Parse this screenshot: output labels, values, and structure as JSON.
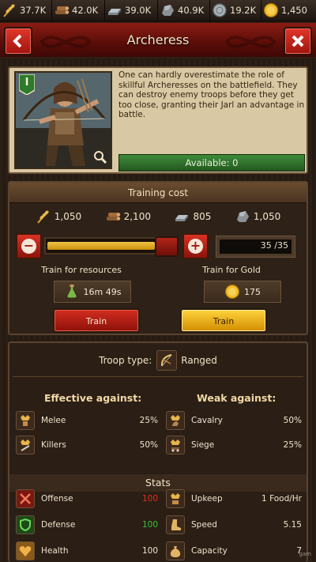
{
  "resources": [
    {
      "name": "food",
      "icon": "wheat-icon",
      "value": "37.7K"
    },
    {
      "name": "wood",
      "icon": "logs-icon",
      "value": "42.0K"
    },
    {
      "name": "iron",
      "icon": "iron-bars-icon",
      "value": "39.0K"
    },
    {
      "name": "stone",
      "icon": "stone-icon",
      "value": "40.9K"
    },
    {
      "name": "silver",
      "icon": "silver-icon",
      "value": "19.2K"
    },
    {
      "name": "gold",
      "icon": "gold-coin-icon",
      "value": "1,450"
    }
  ],
  "header": {
    "title": "Archeress",
    "back_icon": "back-arrow-icon",
    "close_icon": "close-x-icon"
  },
  "unit": {
    "rank": "I",
    "description": "One can hardly overestimate the role of skillful Archeresses on the battlefield. They can destroy enemy troops before they get too close, granting their Jarl an advantage in battle.",
    "available": "Available: 0"
  },
  "training": {
    "title": "Training cost",
    "costs": [
      {
        "icon": "wheat-icon",
        "value": "1,050"
      },
      {
        "icon": "logs-icon",
        "value": "2,100"
      },
      {
        "icon": "iron-bars-icon",
        "value": "805"
      },
      {
        "icon": "stone-icon",
        "value": "1,050"
      }
    ],
    "quantity": "35 /35",
    "slider_fraction": 1.0,
    "resources_label": "Train for resources",
    "gold_label": "Train for Gold",
    "time": "16m 49s",
    "gold_cost": "175",
    "train_label_red": "Train",
    "train_label_gold": "Train"
  },
  "info": {
    "troop_type_label": "Troop type:",
    "troop_type": "Ranged",
    "effective_title": "Effective against:",
    "weak_title": "Weak against:",
    "effective": [
      {
        "name": "Melee",
        "pct": "25%",
        "icon": "melee-icon"
      },
      {
        "name": "Killers",
        "pct": "50%",
        "icon": "killers-icon"
      }
    ],
    "weak": [
      {
        "name": "Cavalry",
        "pct": "50%",
        "icon": "cavalry-icon"
      },
      {
        "name": "Siege",
        "pct": "25%",
        "icon": "siege-icon"
      }
    ],
    "stats_title": "Stats",
    "stats_left": [
      {
        "name": "Offense",
        "value": "100",
        "color": "#e0301e",
        "icon": "crossed-swords-icon"
      },
      {
        "name": "Defense",
        "value": "100",
        "color": "#39c23a",
        "icon": "shield-icon"
      },
      {
        "name": "Health",
        "value": "100",
        "color": "#efe4cd",
        "icon": "heart-icon"
      }
    ],
    "stats_right": [
      {
        "name": "Upkeep",
        "value": "1 Food/Hr",
        "icon": "upkeep-icon"
      },
      {
        "name": "Speed",
        "value": "5.15",
        "icon": "boot-icon"
      },
      {
        "name": "Capacity",
        "value": "7",
        "icon": "sack-icon"
      }
    ]
  },
  "watermark": "gam"
}
